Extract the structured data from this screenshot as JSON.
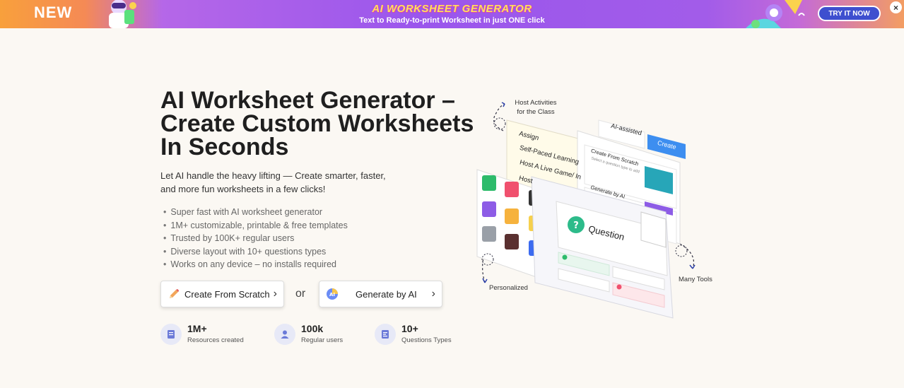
{
  "banner": {
    "new_label": "NEW",
    "title": "AI WORKSHEET GENERATOR",
    "subtitle": "Text to Ready-to-print Worksheet in just ONE click",
    "cta": "TRY IT NOW",
    "close": "×"
  },
  "hero": {
    "title": "AI Worksheet Generator – Create Custom Worksheets In Seconds",
    "description": "Let AI handle the heavy lifting — Create smarter, faster, and more fun worksheets in a few clicks!",
    "features": [
      "Super fast with AI worksheet generator",
      "1M+ customizable, printable & free templates",
      "Trusted by 100K+ regular users",
      "Diverse layout with 10+ questions types",
      "Works on any device – no installs required"
    ],
    "buttons": {
      "scratch": "Create From Scratch",
      "or": "or",
      "ai": "Generate by AI"
    },
    "stats": [
      {
        "value": "1M+",
        "caption": "Resources created",
        "icon": "document-icon"
      },
      {
        "value": "100k",
        "caption": "Regular users",
        "icon": "user-icon"
      },
      {
        "value": "10+",
        "caption": "Questions Types",
        "icon": "list-icon"
      }
    ]
  },
  "illustration": {
    "label_host": "Host Activities for the Class",
    "label_personalized": "Personalized",
    "label_tools": "Many Tools",
    "menu_items": [
      "Assign",
      "Self-Paced Learning",
      "Host A Live Game/ In",
      "Host"
    ],
    "ai_assisted": "AI-assisted",
    "create": "Create",
    "create_from_scratch": "Create From Scratch",
    "select_type": "Select a question type to add",
    "generate_by_ai": "Generate by AI",
    "question": "Question"
  },
  "colors": {
    "accent_blue": "#3e4fcf",
    "create_blue": "#3d8ef0",
    "background": "#fbf8f3"
  }
}
